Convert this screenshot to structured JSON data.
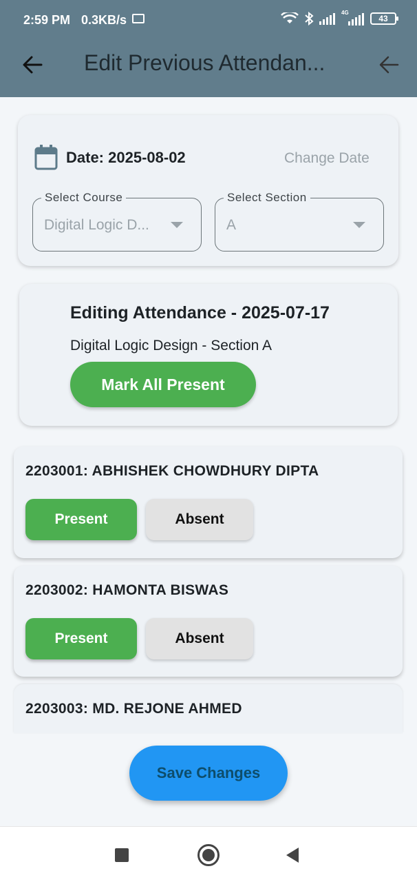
{
  "status_bar": {
    "time": "2:59 PM",
    "speed": "0.3KB/s",
    "network_label": "4G",
    "battery": "43"
  },
  "app_bar": {
    "title": "Edit Previous Attendan..."
  },
  "filter_card": {
    "date_label": "Date: 2025-08-02",
    "change_date": "Change Date",
    "course_field": {
      "label": "Select Course",
      "value": "Digital Logic D..."
    },
    "section_field": {
      "label": "Select Section",
      "value": "A"
    }
  },
  "edit_card": {
    "title": "Editing Attendance - 2025-07-17",
    "subtitle": "Digital Logic Design - Section A",
    "mark_all_label": "Mark All Present"
  },
  "students": [
    {
      "name": "2203001: ABHISHEK CHOWDHURY DIPTA",
      "present_label": "Present",
      "absent_label": "Absent"
    },
    {
      "name": "2203002: HAMONTA BISWAS",
      "present_label": "Present",
      "absent_label": "Absent"
    },
    {
      "name": "2203003: MD. REJONE AHMED"
    }
  ],
  "save_label": "Save Changes",
  "colors": {
    "app_bar": "#617d8c",
    "present_green": "#4caf50",
    "absent_grey": "#e2e2e2",
    "save_blue": "#2196f3"
  }
}
